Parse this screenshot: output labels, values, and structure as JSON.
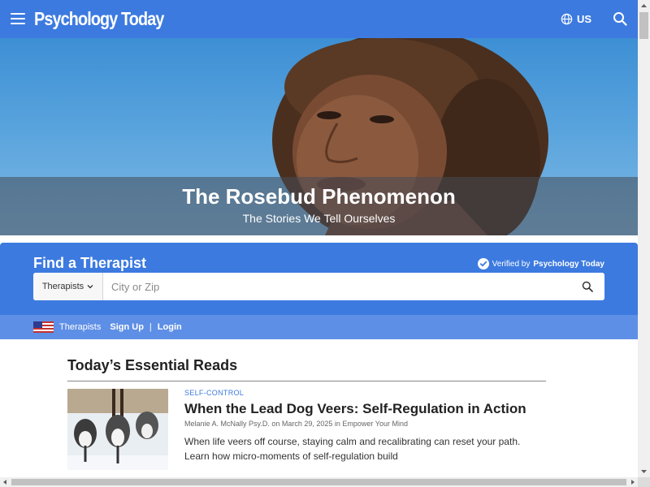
{
  "header": {
    "logo": "Psychology Today",
    "region": "US",
    "menu_icon": "hamburger-menu-icon",
    "region_icon": "globe-icon",
    "search_icon": "search-icon",
    "color": "#3c7ae0"
  },
  "hero": {
    "title": "The Rosebud Phenomenon",
    "subtitle": "The Stories We Tell Ourselves"
  },
  "finder": {
    "title": "Find a Therapist",
    "verified_prefix": "Verified by",
    "verified_brand": "Psychology Today",
    "type_select": "Therapists",
    "city_placeholder": "City or Zip",
    "links": {
      "therapists": "Therapists",
      "signup": "Sign Up",
      "separator": "|",
      "login": "Login"
    }
  },
  "reads": {
    "title": "Today’s Essential Reads",
    "articles": [
      {
        "category": "SELF-CONTROL",
        "title": "When the Lead Dog Veers: Self-Regulation in Action",
        "meta": "Melanie A. McNally Psy.D. on March 29, 2025 in Empower Your Mind",
        "excerpt": "When life veers off course, staying calm and recalibrating can reset your path. Learn how micro-moments of self-regulation build"
      }
    ]
  }
}
